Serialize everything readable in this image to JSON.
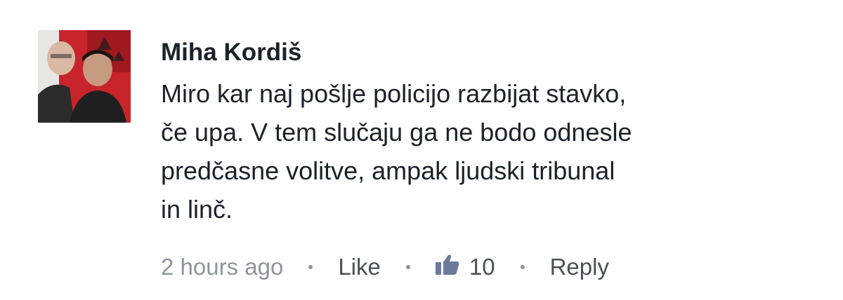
{
  "comment": {
    "author": "Miha Kordiš",
    "text_lines": [
      "Miro kar naj pošlje policijo razbijat stavko,",
      "če upa. V tem slučaju ga ne bodo odnesle",
      "predčasne volitve, ampak ljudski tribunal",
      "in linč."
    ],
    "timestamp": "2 hours ago",
    "like_label": "Like",
    "like_count": "10",
    "reply_label": "Reply",
    "like_icon": "thumbs-up-icon",
    "colors": {
      "author": "#1d2129",
      "text": "#1d2129",
      "meta": "#90949c",
      "avatar_background": "#c8242b"
    }
  }
}
